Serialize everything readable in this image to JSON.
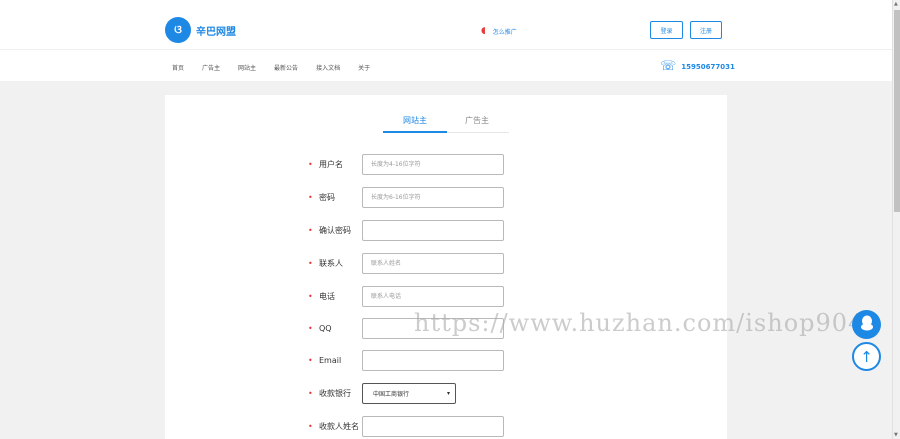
{
  "header": {
    "logo_mark": "ଓ",
    "logo_text": "辛巴网盟",
    "promo_icon": "megaphone-icon",
    "promo_text": "怎么推广",
    "login_label": "登录",
    "register_label": "注册",
    "phone_icon": "phone-icon",
    "phone_number": "15950677031"
  },
  "nav": {
    "items": [
      {
        "label": "首页"
      },
      {
        "label": "广告主"
      },
      {
        "label": "网站主"
      },
      {
        "label": "最新公告"
      },
      {
        "label": "接入文档"
      },
      {
        "label": "关于"
      }
    ]
  },
  "tabs": {
    "webmaster": "网站主",
    "advertiser": "广告主"
  },
  "form": {
    "required_mark": "•",
    "username": {
      "label": "用户名",
      "placeholder": "长度为4-16位字符",
      "value": ""
    },
    "password": {
      "label": "密码",
      "placeholder": "长度为6-16位字符",
      "value": ""
    },
    "confirm_password": {
      "label": "确认密码",
      "placeholder": "",
      "value": ""
    },
    "contact": {
      "label": "联系人",
      "placeholder": "联系人姓名",
      "value": ""
    },
    "phone": {
      "label": "电话",
      "placeholder": "联系人电话",
      "value": ""
    },
    "qq": {
      "label": "QQ",
      "placeholder": "",
      "value": ""
    },
    "email": {
      "label": "Email",
      "placeholder": "",
      "value": ""
    },
    "bank": {
      "label": "收款银行",
      "selected": "中国工商银行"
    },
    "payee_name": {
      "label": "收款人姓名",
      "placeholder": "",
      "value": ""
    }
  },
  "watermark": "https://www.huzhan.com/ishop9043",
  "floating": {
    "qq_icon": "qq-icon",
    "top_icon": "arrow-up-icon"
  },
  "colors": {
    "accent": "#1e88e5",
    "required": "#e53935",
    "background": "#f1f1f1"
  }
}
